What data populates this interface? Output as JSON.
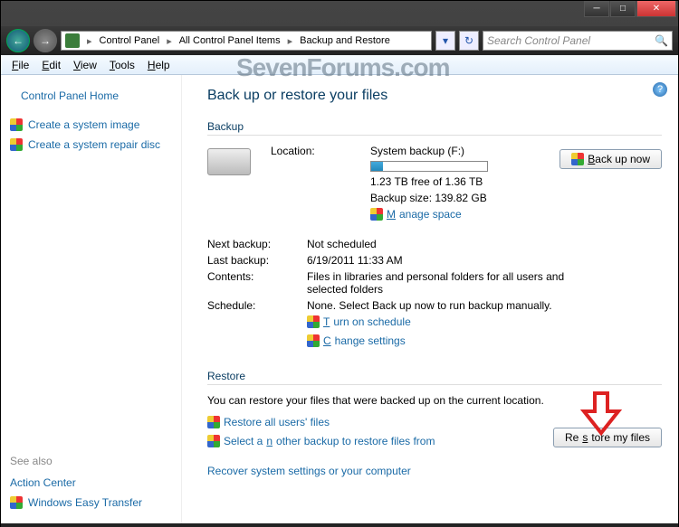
{
  "titlebar": {
    "min": "─",
    "max": "□",
    "close": "✕"
  },
  "nav": {
    "back": "←",
    "fwd": "→",
    "refresh": "↻",
    "dropdown": "▾"
  },
  "breadcrumb": {
    "c1": "Control Panel",
    "c2": "All Control Panel Items",
    "c3": "Backup and Restore",
    "sep": "▸"
  },
  "search": {
    "placeholder": "Search Control Panel",
    "icon": "🔍"
  },
  "menu": {
    "file": "File",
    "edit": "Edit",
    "view": "View",
    "tools": "Tools",
    "help": "Help"
  },
  "watermark": "SevenForums.com",
  "sidebar": {
    "home": "Control Panel Home",
    "link1": "Create a system image",
    "link2": "Create a system repair disc",
    "seealso_hdr": "See also",
    "seealso1": "Action Center",
    "seealso2": "Windows Easy Transfer"
  },
  "main": {
    "help": "?",
    "title": "Back up or restore your files",
    "backup_hdr": "Backup",
    "restore_hdr": "Restore",
    "backup_btn": "Back up now",
    "restore_btn": "Restore my files",
    "rows": {
      "location_lbl": "Location:",
      "location_val": "System backup (F:)",
      "free_space": "1.23 TB free of 1.36 TB",
      "backup_size": "Backup size: 139.82 GB",
      "manage_space": "Manage space",
      "next_lbl": "Next backup:",
      "next_val": "Not scheduled",
      "last_lbl": "Last backup:",
      "last_val": "6/19/2011 11:33 AM",
      "contents_lbl": "Contents:",
      "contents_val": "Files in libraries and personal folders for all users and selected folders",
      "schedule_lbl": "Schedule:",
      "schedule_val": "None. Select Back up now to run backup manually.",
      "turn_on": "Turn on schedule",
      "change": "Change settings"
    },
    "restore": {
      "text": "You can restore your files that were backed up on the current location.",
      "link1": "Restore all users' files",
      "link2": "Select another backup to restore files from",
      "link3": "Recover system settings or your computer"
    },
    "meter_pct": 10
  }
}
